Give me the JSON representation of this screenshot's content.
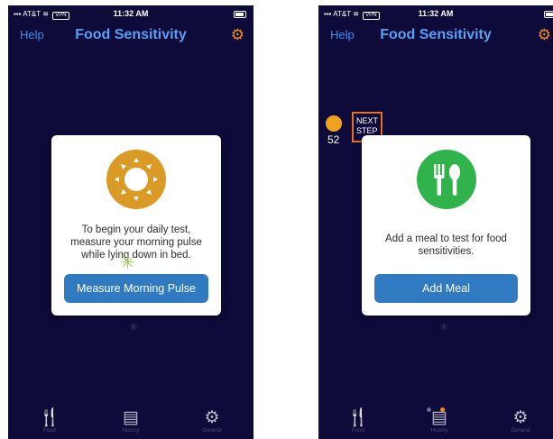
{
  "phone1": {
    "status": {
      "carrier": "AT&T",
      "vpn": "VPN",
      "time": "11:32 AM"
    },
    "nav": {
      "help": "Help",
      "title": "Food Sensitivity",
      "settings_icon": "gear-icon"
    },
    "card": {
      "icon": "sun-icon",
      "message": "To begin your daily test, measure your morning pulse while lying down in bed.",
      "button": "Measure Morning Pulse"
    },
    "tabs": [
      {
        "label": "Food",
        "icon": "utensils-icon"
      },
      {
        "label": "History",
        "icon": "history-icon"
      },
      {
        "label": "General",
        "icon": "gear-icon"
      }
    ]
  },
  "phone2": {
    "status": {
      "carrier": "AT&T",
      "vpn": "VPN",
      "time": "11:32 AM"
    },
    "nav": {
      "help": "Help",
      "title": "Food Sensitivity",
      "settings_icon": "gear-icon"
    },
    "badge_value": "52",
    "next_step": "NEXT STEP",
    "card": {
      "icon": "utensils-icon",
      "message": "Add a meal to test for food sensitivities.",
      "button": "Add Meal"
    },
    "tabs": [
      {
        "label": "Food",
        "icon": "utensils-icon"
      },
      {
        "label": "History",
        "icon": "history-icon"
      },
      {
        "label": "General",
        "icon": "gear-icon"
      }
    ]
  },
  "colors": {
    "background": "#0e0b3a",
    "accent": "#f08a1c",
    "button": "#2f7ac0",
    "link": "#3a8ef0"
  }
}
